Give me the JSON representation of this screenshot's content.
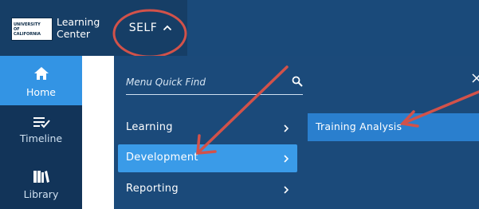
{
  "header": {
    "logo": {
      "line1": "UNIVERSITY",
      "line2": "OF",
      "line3": "CALIFORNIA"
    },
    "app_title_line1": "Learning",
    "app_title_line2": "Center",
    "self_tab": {
      "label": "SELF",
      "icon": "chevron-up-icon"
    }
  },
  "sidebar": {
    "items": [
      {
        "label": "Home",
        "icon": "home-icon",
        "active": true
      },
      {
        "label": "Timeline",
        "icon": "timeline-icon",
        "active": false
      },
      {
        "label": "Library",
        "icon": "library-icon",
        "active": false
      }
    ]
  },
  "menu": {
    "quick_find_placeholder": "Menu Quick Find",
    "items": [
      {
        "label": "Learning",
        "active": false
      },
      {
        "label": "Development",
        "active": true
      },
      {
        "label": "Reporting",
        "active": false
      }
    ],
    "submenu_item": "Training Analysis"
  },
  "colors": {
    "header_bg": "#1a4a7a",
    "menu_bg": "#1b4a7a",
    "active_item": "#3a9be8",
    "annotation_red": "#d2524a"
  }
}
